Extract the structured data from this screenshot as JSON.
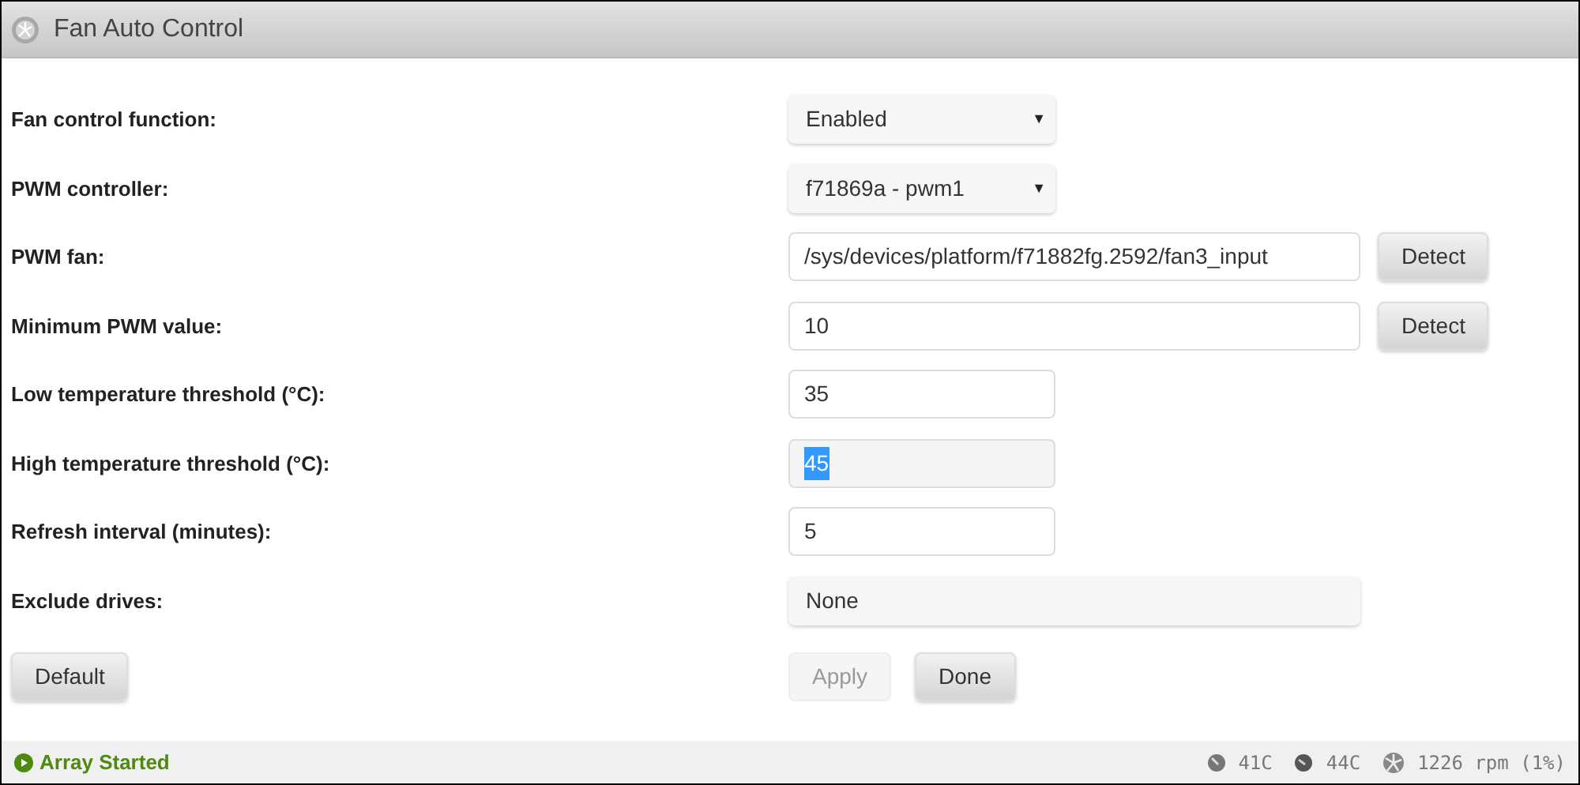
{
  "title": "Fan Auto Control",
  "fields": [
    {
      "label": "Fan control function:",
      "kind": "select",
      "value": "Enabled",
      "arrow": "▼"
    },
    {
      "label": "PWM controller:",
      "kind": "select",
      "value": "f71869a - pwm1",
      "arrow": "▼"
    },
    {
      "label": "PWM fan:",
      "kind": "wide-text",
      "value": "/sys/devices/platform/f71882fg.2592/fan3_input",
      "button": "Detect"
    },
    {
      "label": "Minimum PWM value:",
      "kind": "wide-text",
      "value": "10",
      "button": "Detect"
    },
    {
      "label": "Low temperature threshold (°C):",
      "kind": "text",
      "value": "35"
    },
    {
      "label": "High temperature threshold (°C):",
      "kind": "text",
      "value": "45",
      "highlighted": true
    },
    {
      "label": "Refresh interval (minutes):",
      "kind": "text",
      "value": "5"
    },
    {
      "label": "Exclude drives:",
      "kind": "wide-select",
      "value": "None"
    }
  ],
  "left_buttons": [
    {
      "label": "Default",
      "disabled": false
    }
  ],
  "right_buttons": [
    {
      "label": "Apply",
      "disabled": true
    },
    {
      "label": "Done",
      "disabled": false
    }
  ],
  "status": {
    "text": "Array Started",
    "readings": [
      {
        "kind": "cpu",
        "text": "41C"
      },
      {
        "kind": "board",
        "text": "44C"
      },
      {
        "kind": "fan",
        "text": "1226 rpm (1%)"
      }
    ]
  }
}
